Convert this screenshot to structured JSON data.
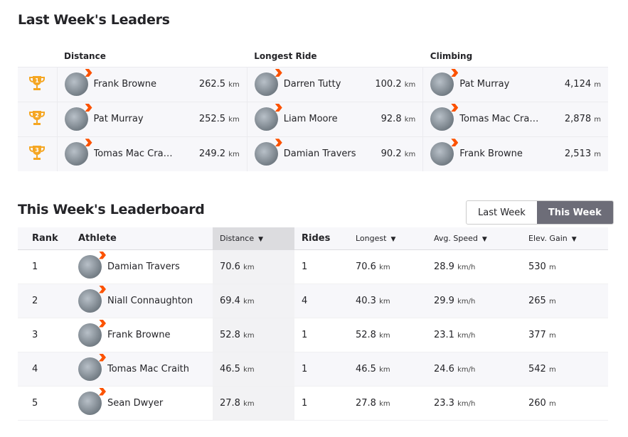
{
  "last_week": {
    "title": "Last Week's Leaders",
    "headers": [
      "Distance",
      "Longest Ride",
      "Climbing"
    ],
    "rows": [
      {
        "rank": "1",
        "distance": {
          "name": "Frank Browne",
          "value": "262.5",
          "unit": "km"
        },
        "longest": {
          "name": "Darren Tutty",
          "value": "100.2",
          "unit": "km"
        },
        "climbing": {
          "name": "Pat Murray",
          "value": "4,124",
          "unit": "m"
        }
      },
      {
        "rank": "2",
        "distance": {
          "name": "Pat Murray",
          "value": "252.5",
          "unit": "km"
        },
        "longest": {
          "name": "Liam Moore",
          "value": "92.8",
          "unit": "km"
        },
        "climbing": {
          "name": "Tomas Mac Cra…",
          "value": "2,878",
          "unit": "m"
        }
      },
      {
        "rank": "3",
        "distance": {
          "name": "Tomas Mac Cra…",
          "value": "249.2",
          "unit": "km"
        },
        "longest": {
          "name": "Damian Travers",
          "value": "90.2",
          "unit": "km"
        },
        "climbing": {
          "name": "Frank Browne",
          "value": "2,513",
          "unit": "m"
        }
      }
    ],
    "trophy_color": "#f5a623"
  },
  "this_week": {
    "title": "This Week's Leaderboard",
    "toggle": {
      "last": "Last Week",
      "this": "This Week",
      "selected": "This Week"
    },
    "headers": {
      "rank": "Rank",
      "athlete": "Athlete",
      "distance": "Distance",
      "rides": "Rides",
      "longest": "Longest",
      "speed": "Avg. Speed",
      "elev": "Elev. Gain",
      "sort_icon": "▼"
    },
    "rows": [
      {
        "rank": "1",
        "name": "Damian Travers",
        "distance": "70.6",
        "rides": "1",
        "longest": "70.6",
        "speed": "28.9",
        "elev": "530"
      },
      {
        "rank": "2",
        "name": "Niall Connaughton",
        "distance": "69.4",
        "rides": "4",
        "longest": "40.3",
        "speed": "29.9",
        "elev": "265"
      },
      {
        "rank": "3",
        "name": "Frank Browne",
        "distance": "52.8",
        "rides": "1",
        "longest": "52.8",
        "speed": "23.1",
        "elev": "377"
      },
      {
        "rank": "4",
        "name": "Tomas Mac Craith",
        "distance": "46.5",
        "rides": "1",
        "longest": "46.5",
        "speed": "24.6",
        "elev": "542"
      },
      {
        "rank": "5",
        "name": "Sean Dwyer",
        "distance": "27.8",
        "rides": "1",
        "longest": "27.8",
        "speed": "23.3",
        "elev": "260"
      }
    ],
    "units": {
      "km": "km",
      "speed": "km/h",
      "m": "m"
    }
  },
  "accent": "#fc5200"
}
